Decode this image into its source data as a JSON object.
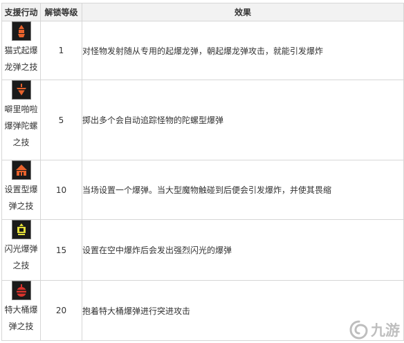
{
  "table": {
    "headers": {
      "action": "支援行动",
      "level": "解锁等级",
      "effect": "效果"
    },
    "rows": [
      {
        "icon": "bomb-launcher-icon",
        "name": "猫式起爆龙弹之技",
        "level": "1",
        "effect": "对怪物发射随从专用的起爆龙弹，朝起爆龙弹攻击，就能引发爆炸"
      },
      {
        "icon": "spinning-top-bomb-icon",
        "name": "噼里啪啦爆弹陀螺之技",
        "level": "5",
        "effect": "掷出多个会自动追踪怪物的陀螺型爆弹"
      },
      {
        "icon": "placed-bomb-icon",
        "name": "设置型爆弹之技",
        "level": "10",
        "effect": "当场设置一个爆弹。当大型魔物触碰到后便会引发爆炸，并使其畏缩"
      },
      {
        "icon": "flash-bomb-icon",
        "name": "闪光爆弹之技",
        "level": "15",
        "effect": "设置在空中爆炸后会发出强烈闪光的爆弹"
      },
      {
        "icon": "barrel-bomb-icon",
        "name": "特大桶爆弹之技",
        "level": "20",
        "effect": "抱着特大桶爆弹进行突进攻击"
      }
    ]
  },
  "watermark": {
    "text": "九游"
  }
}
